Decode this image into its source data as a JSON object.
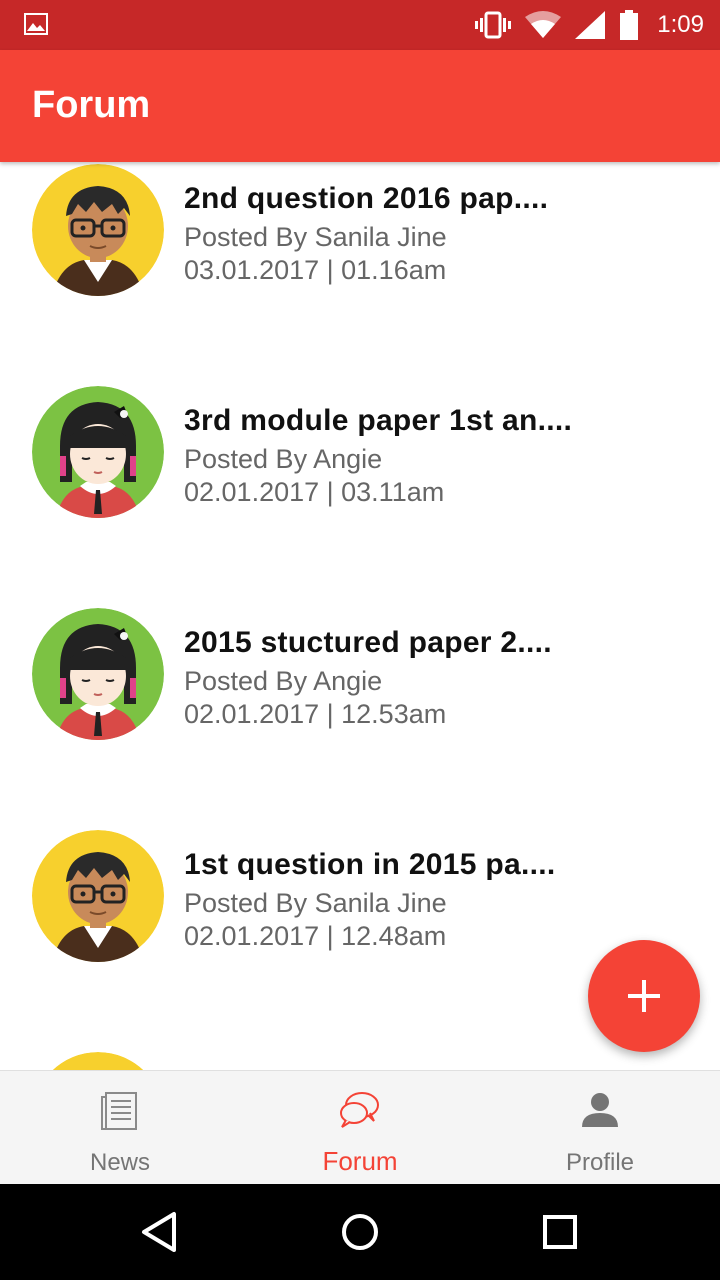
{
  "status_bar": {
    "time": "1:09",
    "icons": [
      "image-icon",
      "vibrate-icon",
      "wifi-icon",
      "signal-icon",
      "battery-icon"
    ]
  },
  "app_bar": {
    "title": "Forum"
  },
  "posts": [
    {
      "title": "2nd question 2016 pap....",
      "author": "Posted By Sanila Jine",
      "date": "03.01.2017 | 01.16am",
      "avatar": "boy-avatar"
    },
    {
      "title": "3rd module paper 1st an....",
      "author": "Posted By Angie",
      "date": "02.01.2017 | 03.11am",
      "avatar": "girl-avatar"
    },
    {
      "title": "2015 stuctured paper 2....",
      "author": "Posted By Angie",
      "date": "02.01.2017 | 12.53am",
      "avatar": "girl-avatar"
    },
    {
      "title": "1st question in 2015 pa....",
      "author": "Posted By Sanila Jine",
      "date": "02.01.2017 | 12.48am",
      "avatar": "boy-avatar"
    }
  ],
  "fab": {
    "icon": "plus-icon"
  },
  "bottom_nav": {
    "items": [
      {
        "label": "News",
        "icon": "news-icon",
        "active": false
      },
      {
        "label": "Forum",
        "icon": "forum-icon",
        "active": true
      },
      {
        "label": "Profile",
        "icon": "profile-icon",
        "active": false
      }
    ]
  },
  "colors": {
    "status_bar": "#c62828",
    "primary": "#f44336",
    "secondary_text": "#666666"
  }
}
